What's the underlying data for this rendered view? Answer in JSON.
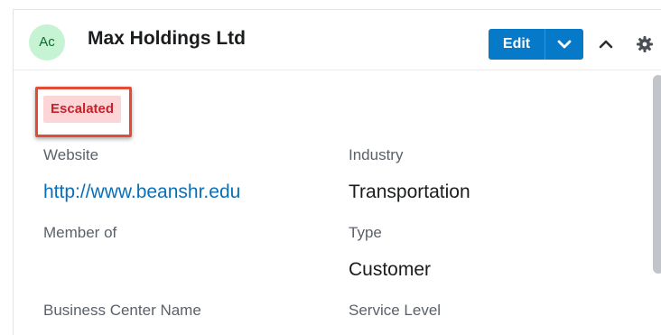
{
  "record": {
    "avatar_initials": "Ac",
    "title": "Max Holdings Ltd",
    "badge": "Escalated"
  },
  "actions": {
    "edit_label": "Edit"
  },
  "icons": {
    "caret": "chevron-down-icon",
    "collapse": "chevron-up-icon",
    "settings": "gear-icon"
  },
  "fields": {
    "website": {
      "label": "Website",
      "value": "http://www.beanshr.edu"
    },
    "industry": {
      "label": "Industry",
      "value": "Transportation"
    },
    "member_of": {
      "label": "Member of",
      "value": ""
    },
    "type": {
      "label": "Type",
      "value": "Customer"
    },
    "business_center": {
      "label": "Business Center Name"
    },
    "service_level": {
      "label": "Service Level"
    }
  },
  "colors": {
    "primary": "#0679c8",
    "badge_bg": "#fcd6d6",
    "badge_text": "#c8212b",
    "highlight": "#e24b36",
    "avatar_bg": "#c6f3d3"
  }
}
